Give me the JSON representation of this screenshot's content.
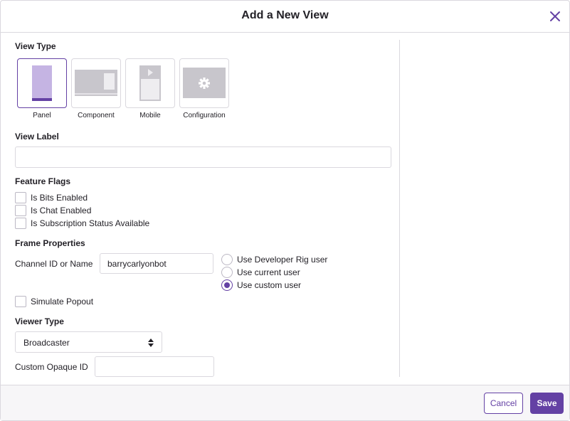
{
  "dialog": {
    "title": "Add a New View",
    "close_icon": "close-icon"
  },
  "view_type": {
    "label": "View Type",
    "selected": "Panel",
    "options": [
      {
        "label": "Panel",
        "icon": "panel-view-icon"
      },
      {
        "label": "Component",
        "icon": "component-view-icon"
      },
      {
        "label": "Mobile",
        "icon": "mobile-view-icon"
      },
      {
        "label": "Configuration",
        "icon": "gear-icon"
      }
    ]
  },
  "view_label": {
    "label": "View Label",
    "value": "",
    "placeholder": ""
  },
  "feature_flags": {
    "label": "Feature Flags",
    "items": [
      {
        "label": "Is Bits Enabled",
        "checked": false
      },
      {
        "label": "Is Chat Enabled",
        "checked": false
      },
      {
        "label": "Is Subscription Status Available",
        "checked": false
      }
    ]
  },
  "frame_properties": {
    "label": "Frame Properties",
    "channel_label": "Channel ID or Name",
    "channel_value": "barrycarlyonbot",
    "user_options": [
      {
        "label": "Use Developer Rig user",
        "checked": false
      },
      {
        "label": "Use current user",
        "checked": false
      },
      {
        "label": "Use custom user",
        "checked": true
      }
    ],
    "simulate_popout": {
      "label": "Simulate Popout",
      "checked": false
    }
  },
  "viewer_type": {
    "label": "Viewer Type",
    "selected": "Broadcaster",
    "custom_opaque_label": "Custom Opaque ID",
    "custom_opaque_value": ""
  },
  "footer": {
    "cancel_label": "Cancel",
    "save_label": "Save"
  },
  "colors": {
    "accent": "#6441a4",
    "border": "#dad8de",
    "preview_gray": "#c8c6cc",
    "panel_lilac": "#c5b4e3"
  }
}
